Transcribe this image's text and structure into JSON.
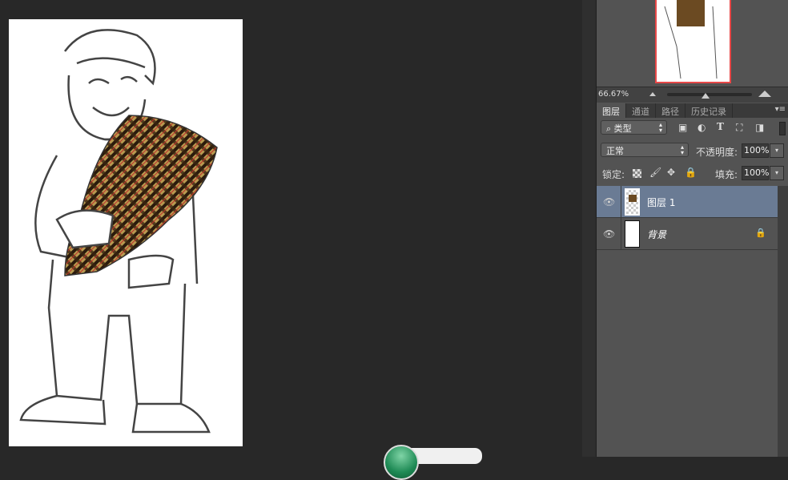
{
  "navigator": {
    "zoom": "66.67%"
  },
  "panel_tabs": [
    {
      "label": "图层",
      "active": true
    },
    {
      "label": "通道"
    },
    {
      "label": "路径"
    },
    {
      "label": "历史记录"
    }
  ],
  "filter": {
    "kind": "类型"
  },
  "blend": {
    "mode": "正常",
    "opacity_label": "不透明度:",
    "opacity": "100%"
  },
  "lock": {
    "label": "锁定:",
    "fill_label": "填充:",
    "fill": "100%"
  },
  "layers": [
    {
      "name": "图层 1",
      "selected": true
    },
    {
      "name": "背景",
      "locked": true
    }
  ],
  "colors": {
    "panel": "#535353",
    "selected": "#6a7b94",
    "canvas": "#282828",
    "nav_border": "#e84848"
  }
}
